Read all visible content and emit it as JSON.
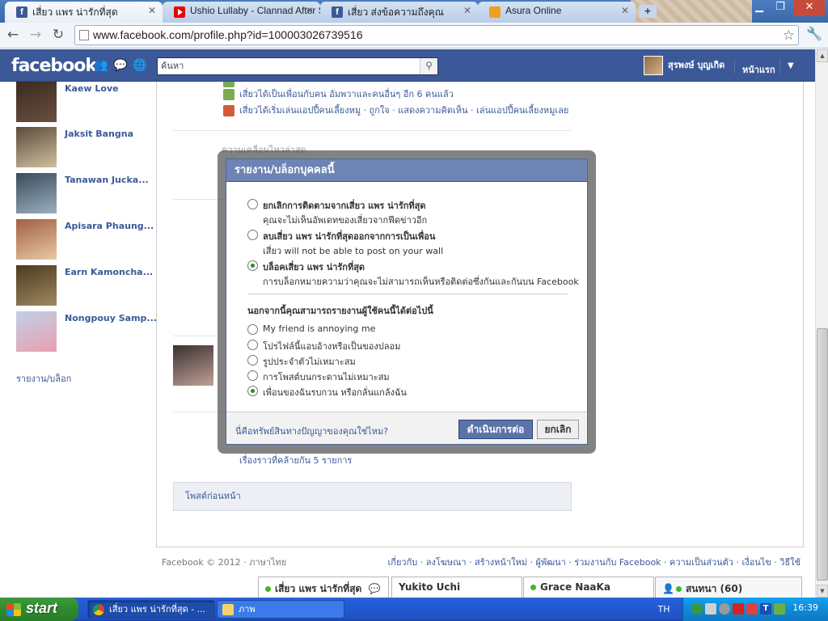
{
  "browser": {
    "tabs": [
      {
        "title": "เสี่ยว แพร น่ารักที่สุด",
        "icon": "facebook-icon",
        "active": true
      },
      {
        "title": "Ushio Lullaby - Clannad After S",
        "icon": "youtube-icon",
        "active": false
      },
      {
        "title": "เสี่ยว ส่งข้อความถึงคุณ",
        "icon": "facebook-icon",
        "active": false
      },
      {
        "title": "Asura Online",
        "icon": "asura-icon",
        "active": false
      }
    ],
    "url": "www.facebook.com/profile.php?id=100003026739516",
    "new_tab": "+"
  },
  "fb_header": {
    "logo": "facebook",
    "search_placeholder": "ค้นหา",
    "user_name": "สุรพงษ์ บุญเกิด",
    "home": "หน้าแรก"
  },
  "friends": [
    {
      "name": "Kaew Love",
      "color": "#4a3a30"
    },
    {
      "name": "Jaksit Bangna",
      "color": "#6b5a4a"
    },
    {
      "name": "Tanawan Jucka...",
      "color": "#5a7a8a"
    },
    {
      "name": "Apisara Phaung...",
      "color": "#c9906a"
    },
    {
      "name": "Earn Kamoncha...",
      "color": "#7a6040"
    },
    {
      "name": "Nongpouy Samp...",
      "color": "#8aa0c0"
    }
  ],
  "report_block_link": "รายงาน/บล็อก",
  "stories": [
    "เสี่ยวได้เป็นเพื่อนกับคน อัมพวาและคนอื่นๆ อีก 6 คนแล้ว",
    "เสี่ยวได้เริ่มเล่นแอปปี้คนเลี้ยงหมู · ถูกใจ · แสดงความคิดเห็น · เล่นแอปปี้คนเลี้ยงหมูเลย"
  ],
  "section_label": "ความเคลื่อนไหวล่าสุด",
  "similar_stories": "เรื่องราวที่คล้ายกัน 5 รายการ",
  "older_posts": "โพสต์ก่อนหน้า",
  "footer": {
    "copyright": "Facebook © 2012 · ภาษาไทย",
    "links": "เกี่ยวกับ · ลงโฆษณา · สร้างหน้าใหม่ · ผู้พัฒนา · ร่วมงานกับ Facebook · ความเป็นส่วนตัว · เงื่อนไข · วิธีใช้"
  },
  "dialog": {
    "title": "รายงาน/บล็อกบุคคลนี้",
    "options": [
      {
        "label": "ยกเลิกการติดตามจากเสี่ยว แพร น่ารักที่สุด",
        "sub": "คุณจะไม่เห็นอัพเดทของเสี่ยวจากฟีดข่าวอีก",
        "selected": false
      },
      {
        "label": "ลบเสี่ยว แพร น่ารักที่สุดออกจากการเป็นเพื่อน",
        "sub": "เสี่ยว will not be able to post on your wall",
        "selected": false
      },
      {
        "label": "บล็อคเสี่ยว แพร น่ารักที่สุด",
        "sub": "การบล็อกหมายความว่าคุณจะไม่สามารถเห็นหรือติดต่อซึ่งกันและกันบน Facebook",
        "selected": true
      }
    ],
    "reason_title": "นอกจากนี้คุณสามารถรายงานผู้ใช้คนนี้ได้ต่อไปนี้",
    "reasons": [
      {
        "label": "My friend is annoying me",
        "selected": false
      },
      {
        "label": "โปรไฟล์นี้แอบอ้างหรือเป็นของปลอม",
        "selected": false
      },
      {
        "label": "รูปประจำตัวไม่เหมาะสม",
        "selected": false
      },
      {
        "label": "การโพสต์บนกระดานไม่เหมาะสม",
        "selected": false
      },
      {
        "label": "เพื่อนของฉันรบกวน หรือกลั่นแกล้งฉัน",
        "selected": true
      }
    ],
    "help_link": "นี่คือทรัพย์สินทางปัญญาของคุณใช่ไหม?",
    "continue_label": "ดำเนินการต่อ",
    "cancel_label": "ยกเลิก"
  },
  "chat": [
    {
      "name": "เสี่ยว แพร น่ารักที่สุด",
      "online": true
    },
    {
      "name": "Yukito Uchi",
      "online": false
    },
    {
      "name": "Grace NaaKa",
      "online": true
    },
    {
      "name": "สนทนา (60)",
      "online": true
    }
  ],
  "taskbar": {
    "start": "start",
    "tasks": [
      "เสี่ยว แพร น่ารักที่สุด - ...",
      "ภาพ"
    ],
    "lang": "TH",
    "clock": "16:39"
  },
  "colors": {
    "fb_blue": "#3b5998",
    "dialog_header": "#6d84b4",
    "online_green": "#42b72a"
  }
}
